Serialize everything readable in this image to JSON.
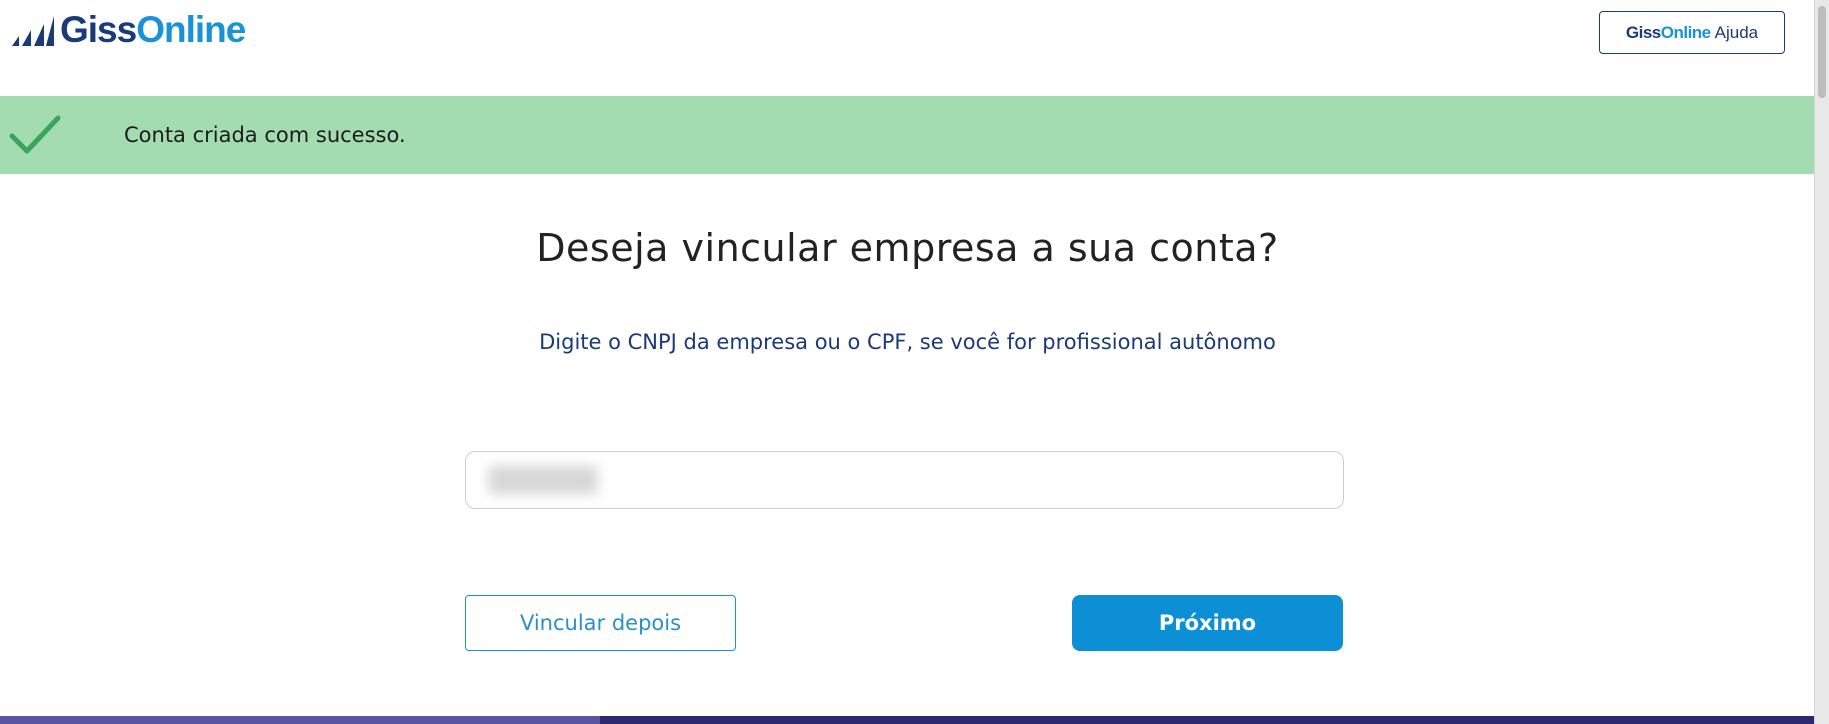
{
  "header": {
    "logo": {
      "part1": "Giss",
      "part2": "Online"
    },
    "help_button": {
      "part1": "Giss",
      "part2": "Online",
      "part3": "Ajuda"
    }
  },
  "banner": {
    "message": "Conta criada com sucesso.",
    "color": "#a4dcb1",
    "icon": "check-icon"
  },
  "main": {
    "title": "Deseja vincular empresa a sua conta?",
    "subtitle": "Digite o CNPJ da empresa ou o CPF, se você for profissional autônomo",
    "input": {
      "value": "",
      "placeholder": ""
    },
    "later_button": "Vincular depois",
    "next_button": "Próximo"
  },
  "colors": {
    "brand_dark": "#1b3a78",
    "brand_light": "#1a93d6",
    "primary_button": "#0d8fd6"
  }
}
